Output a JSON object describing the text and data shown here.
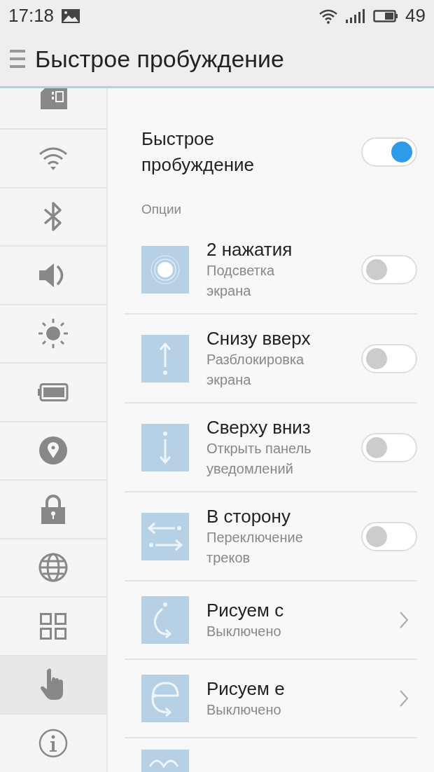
{
  "status_bar": {
    "time": "17:18",
    "battery_percent": "49"
  },
  "header": {
    "title": "Быстрое пробуждение"
  },
  "sidebar": {
    "items": [
      {
        "kind": "sim",
        "selected": false
      },
      {
        "kind": "wifi",
        "selected": false
      },
      {
        "kind": "bluetooth",
        "selected": false
      },
      {
        "kind": "sound",
        "selected": false
      },
      {
        "kind": "brightness",
        "selected": false
      },
      {
        "kind": "battery",
        "selected": false
      },
      {
        "kind": "location",
        "selected": false
      },
      {
        "kind": "lock",
        "selected": false
      },
      {
        "kind": "language",
        "selected": false
      },
      {
        "kind": "apps",
        "selected": false
      },
      {
        "kind": "gesture",
        "selected": true
      },
      {
        "kind": "info",
        "selected": false
      }
    ]
  },
  "main_switch": {
    "label": "Быстрое пробуждение",
    "on": true
  },
  "section": {
    "title": "Опции"
  },
  "options": [
    {
      "kind": "toggle",
      "icon": {
        "kind": "tap"
      },
      "title": "2 нажатия",
      "subtitle": "Подсветка экрана",
      "on": false
    },
    {
      "kind": "toggle",
      "icon": {
        "kind": "up"
      },
      "title": "Снизу вверх",
      "subtitle": "Разблокировка экрана",
      "on": false
    },
    {
      "kind": "toggle",
      "icon": {
        "kind": "down"
      },
      "title": "Сверху вниз",
      "subtitle": "Открыть панель уведомлений",
      "on": false
    },
    {
      "kind": "toggle",
      "icon": {
        "kind": "side"
      },
      "title": "В сторону",
      "subtitle": "Переключение треков",
      "on": false
    },
    {
      "kind": "link",
      "icon": {
        "kind": "c"
      },
      "title": "Рисуем с",
      "subtitle": "Выключено"
    },
    {
      "kind": "link",
      "icon": {
        "kind": "e"
      },
      "title": "Рисуем е",
      "subtitle": "Выключено"
    },
    {
      "kind": "stub",
      "icon": {
        "kind": "m"
      }
    }
  ]
}
